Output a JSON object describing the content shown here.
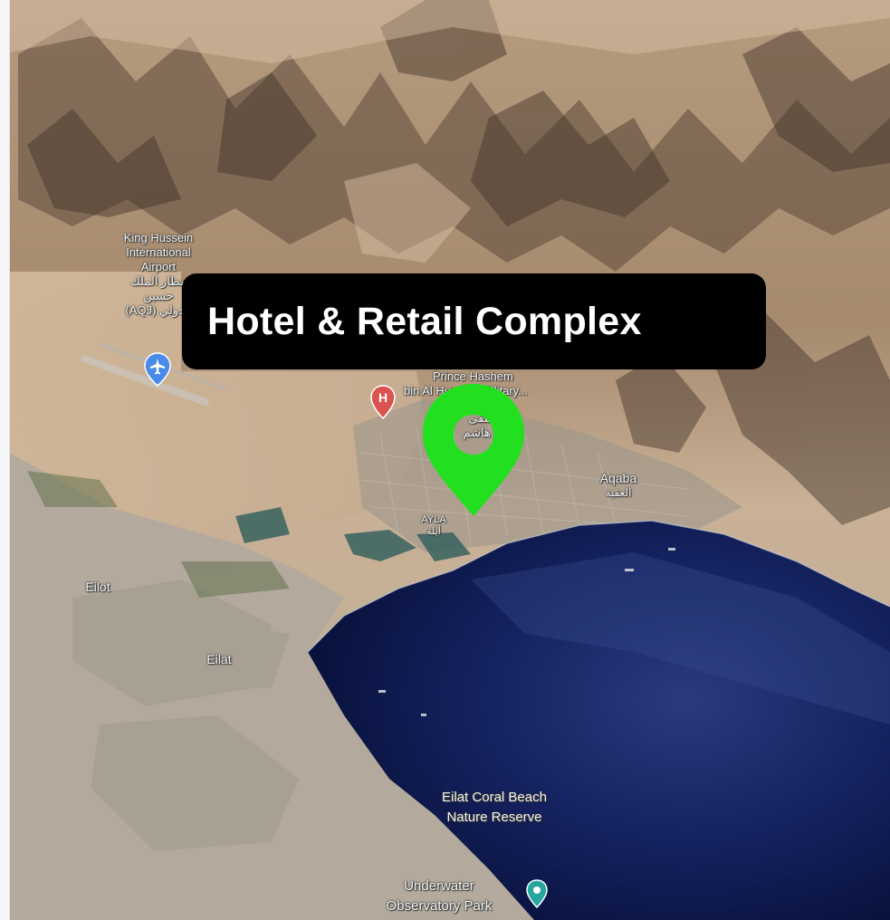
{
  "callout": {
    "title": "Hotel & Retail Complex"
  },
  "labels": {
    "airport": [
      "King Hussein",
      "International",
      "Airport",
      "مطار الملك",
      "حسين",
      "(AQJ) الدولي"
    ],
    "military": [
      "Prince Hashem",
      "bin Al Hussein Military..."
    ],
    "military_ar": [
      "مستشفى",
      "الأمير هاشم"
    ],
    "aqaba": "Aqaba",
    "aqaba_ar": "العقبة",
    "ayla": "AYLA",
    "ayla_ar": "أيلة",
    "eilot": "Eilot",
    "eilat": "Eilat",
    "coral_beach": [
      "Eilat Coral Beach",
      "Nature Reserve"
    ],
    "observatory": [
      "Underwater",
      "Observatory Park"
    ]
  },
  "icons": {
    "airport": "airplane-icon",
    "hospital": "hospital-icon",
    "park": "park-icon",
    "pin": "location-pin-icon"
  },
  "colors": {
    "pin": "#22e01f",
    "callout_bg": "#000000",
    "airport_marker": "#4a8ae8",
    "hospital_marker": "#d9534f",
    "sea": "#0d1848"
  }
}
